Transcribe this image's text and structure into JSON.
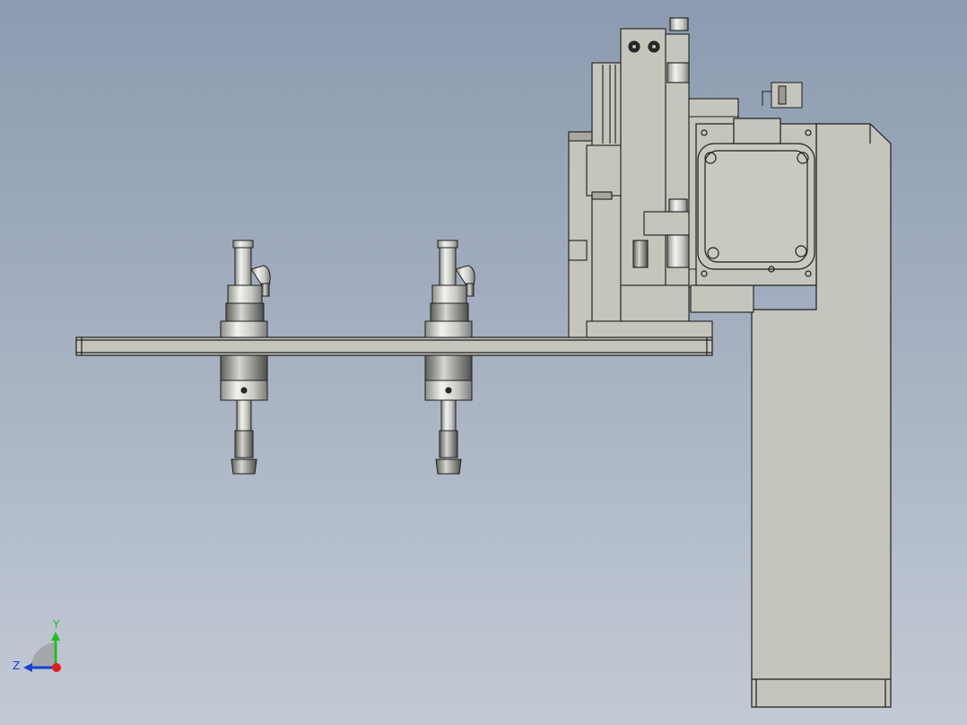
{
  "viewport": {
    "background_top": "#8c9bb0",
    "background_bottom": "#c3cad5",
    "part_color": "#c5c5bc",
    "part_shade": "#a8a89f",
    "metal_color": "#d9d9d6",
    "edge_color": "#1e1e1e"
  },
  "triad": {
    "y_label": "Y",
    "z_label": "Z",
    "y_color": "#1fbf1f",
    "z_color": "#1a3fd6",
    "x_color": "#e01e1e"
  }
}
